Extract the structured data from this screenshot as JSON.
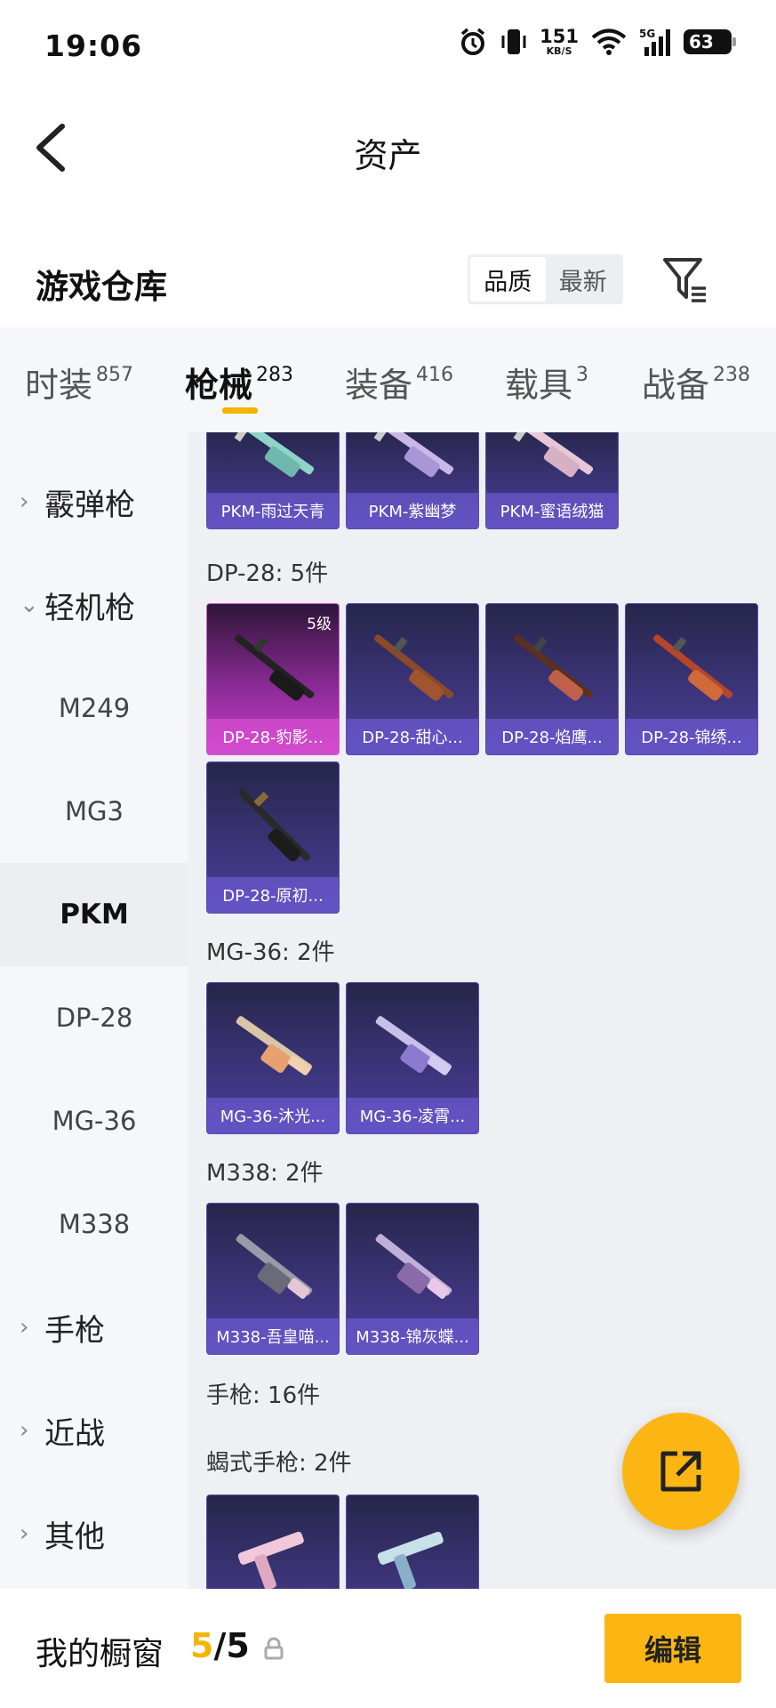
{
  "status_bar": {
    "time": "19:06",
    "net_speed": "151",
    "net_unit": "KB/S",
    "net_type": "5G",
    "battery": "63"
  },
  "nav": {
    "title": "资产",
    "back_icon": "chevron-left-icon"
  },
  "warehouse": {
    "title": "游戏仓库",
    "sort_options": [
      "品质",
      "最新"
    ],
    "sort_active": "品质",
    "filter_icon": "filter-icon"
  },
  "tabs": [
    {
      "label": "时装",
      "count": "857"
    },
    {
      "label": "枪械",
      "count": "283"
    },
    {
      "label": "装备",
      "count": "416"
    },
    {
      "label": "载具",
      "count": "3"
    },
    {
      "label": "战备",
      "count": "238"
    }
  ],
  "active_tab": "枪械",
  "sidebar": {
    "items": [
      {
        "label": "霰弹枪",
        "type": "category",
        "expanded": false
      },
      {
        "label": "轻机枪",
        "type": "category",
        "expanded": true
      },
      {
        "label": "M249",
        "type": "sub"
      },
      {
        "label": "MG3",
        "type": "sub"
      },
      {
        "label": "PKM",
        "type": "sub",
        "active": true
      },
      {
        "label": "DP-28",
        "type": "sub"
      },
      {
        "label": "MG-36",
        "type": "sub"
      },
      {
        "label": "M338",
        "type": "sub"
      },
      {
        "label": "手枪",
        "type": "category",
        "expanded": false
      },
      {
        "label": "近战",
        "type": "category",
        "expanded": false
      },
      {
        "label": "其他",
        "type": "category",
        "expanded": false
      }
    ]
  },
  "content": {
    "pkm_row": [
      "PKM-雨过天青",
      "PKM-紫幽梦",
      "PKM-蜜语绒猫"
    ],
    "dp28": {
      "title": "DP-28: 5件",
      "items": [
        "DP-28-豹影...",
        "DP-28-甜心...",
        "DP-28-焰鹰...",
        "DP-28-锦绣...",
        "DP-28-原初..."
      ],
      "first_level": "5级"
    },
    "mg36": {
      "title": "MG-36: 2件",
      "items": [
        "MG-36-沐光...",
        "MG-36-凌霄..."
      ]
    },
    "m338": {
      "title": "M338: 2件",
      "items": [
        "M338-吾皇喵...",
        "M338-锦灰蝶..."
      ]
    },
    "pistol_title": "手枪: 16件",
    "scorpion_title": "蝎式手枪: 2件"
  },
  "fab_icon": "share-icon",
  "bottom_bar": {
    "title": "我的橱窗",
    "current": "5",
    "sep": "/",
    "max": "5",
    "lock_icon": "lock-icon",
    "edit_label": "编辑"
  },
  "colors": {
    "accent": "#fbb614",
    "card": "#3b3478",
    "card_highlight": "#c93ec6"
  }
}
